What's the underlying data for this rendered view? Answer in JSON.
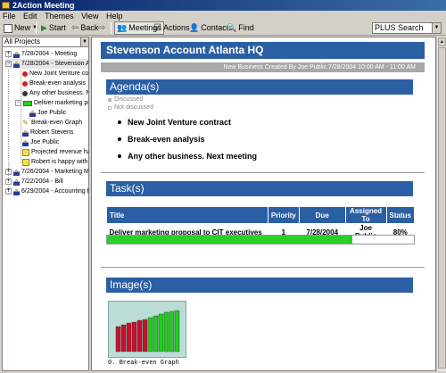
{
  "window": {
    "title": "2Action Meeting"
  },
  "menu": [
    "File",
    "Edit",
    "Themes",
    "View",
    "Help"
  ],
  "toolbar": {
    "new_label": "New",
    "start_label": "Start",
    "back_label": "Back",
    "meetings_label": "Meetings",
    "actions_label": "Actions",
    "contacts_label": "Contacts",
    "find_label": "Find"
  },
  "search": {
    "value": "PLUS Search"
  },
  "sidebar": {
    "project_filter": "All Projects",
    "items": [
      {
        "label": "7/28/2004 - Meeting",
        "icon": "meeting-icon"
      },
      {
        "label": "7/28/2004 - Stevenson Acco",
        "icon": "meeting-icon"
      },
      {
        "label": "New Joint Venture cont",
        "icon": "red-dot-icon"
      },
      {
        "label": "Break-even analysis",
        "icon": "red-dot-icon"
      },
      {
        "label": "Any other business. Ne",
        "icon": "dark-dot-icon"
      },
      {
        "label": "Deliver marketing propo",
        "icon": "task-icon"
      },
      {
        "label": "Joe Public",
        "icon": "person-icon"
      },
      {
        "label": "Break-even Graph",
        "icon": "pencil-icon"
      },
      {
        "label": "Robert Stevens",
        "icon": "person-icon"
      },
      {
        "label": "Joe Public",
        "icon": "person-icon"
      },
      {
        "label": "Projected revenue has",
        "icon": "note-icon"
      },
      {
        "label": "Robert is happy with m",
        "icon": "note-icon"
      },
      {
        "label": "7/26/2004 - Marketing Meet",
        "icon": "meeting-icon"
      },
      {
        "label": "7/22/2004 - Bill",
        "icon": "meeting-icon"
      },
      {
        "label": "6/29/2004 - Accounting Rev",
        "icon": "meeting-icon"
      }
    ]
  },
  "document": {
    "title": "Stevenson Account Atlanta HQ",
    "subtitle": "New Business Created By Joe Public 7/28/2004 10:00 AM - 11:00 AM",
    "agenda": {
      "heading": "Agenda(s)",
      "legend_discussed": "Discussed",
      "legend_not_discussed": "Not discussed",
      "items": [
        "New Joint Venture contract",
        "Break-even analysis",
        "Any other business. Next meeting"
      ]
    },
    "tasks": {
      "heading": "Task(s)",
      "columns": [
        "Title",
        "Priority",
        "Due",
        "Assigned To",
        "Status"
      ],
      "rows": [
        {
          "title": "Deliver marketing proposal to CIT executives",
          "priority": "1",
          "due": "7/28/2004",
          "assigned_to": "Joe Public",
          "status": "80%",
          "progress": 0.8
        }
      ]
    },
    "images": {
      "heading": "Image(s)",
      "caption": "0. Break-even Graph"
    }
  },
  "colors": {
    "accent": "#2b5fa3",
    "progress": "#28d028",
    "bars_red": "#c8102e",
    "bars_green": "#22cc22"
  }
}
